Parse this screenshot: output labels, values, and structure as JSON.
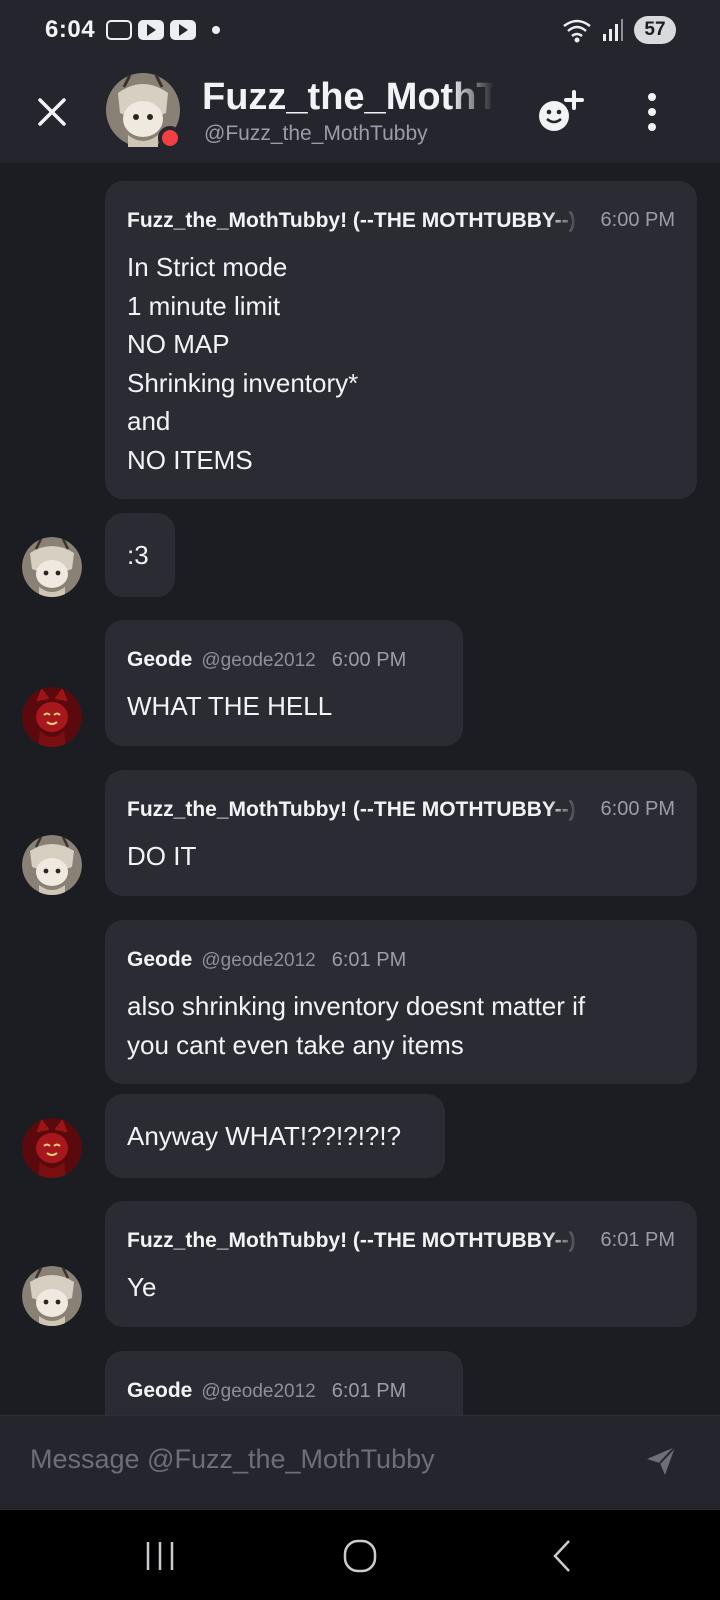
{
  "status_bar": {
    "time": "6:04",
    "battery": "57"
  },
  "header": {
    "name": "Fuzz_the_MothTubby",
    "handle": "@Fuzz_the_MothTubby"
  },
  "messages": [
    {
      "author": "Fuzz_the_MothTubby! (--THE MOTHTUBBY--)",
      "time": "6:00 PM",
      "text": "In Strict mode\n1 minute limit\nNO MAP\nShrinking inventory*\nand\nNO ITEMS"
    },
    {
      "text": ":3"
    },
    {
      "author": "Geode",
      "handle": "@geode2012",
      "time": "6:00 PM",
      "text": "WHAT THE HELL"
    },
    {
      "author": "Fuzz_the_MothTubby! (--THE MOTHTUBBY--)",
      "time": "6:00 PM",
      "text": "DO IT"
    },
    {
      "author": "Geode",
      "handle": "@geode2012",
      "time": "6:01 PM",
      "text": "also shrinking inventory doesnt matter if\nyou cant even take any items"
    },
    {
      "text": "Anyway WHAT!??!?!?!?"
    },
    {
      "author": "Fuzz_the_MothTubby! (--THE MOTHTUBBY--)",
      "time": "6:01 PM",
      "text": "Ye"
    },
    {
      "author": "Geode",
      "handle": "@geode2012",
      "time": "6:01 PM"
    }
  ],
  "composer": {
    "placeholder": "Message @Fuzz_the_MothTubby"
  },
  "colors": {
    "background": "#1c1d23",
    "bubble": "#2b2c33",
    "header": "#25262d",
    "presence_dnd": "#f23f43"
  }
}
